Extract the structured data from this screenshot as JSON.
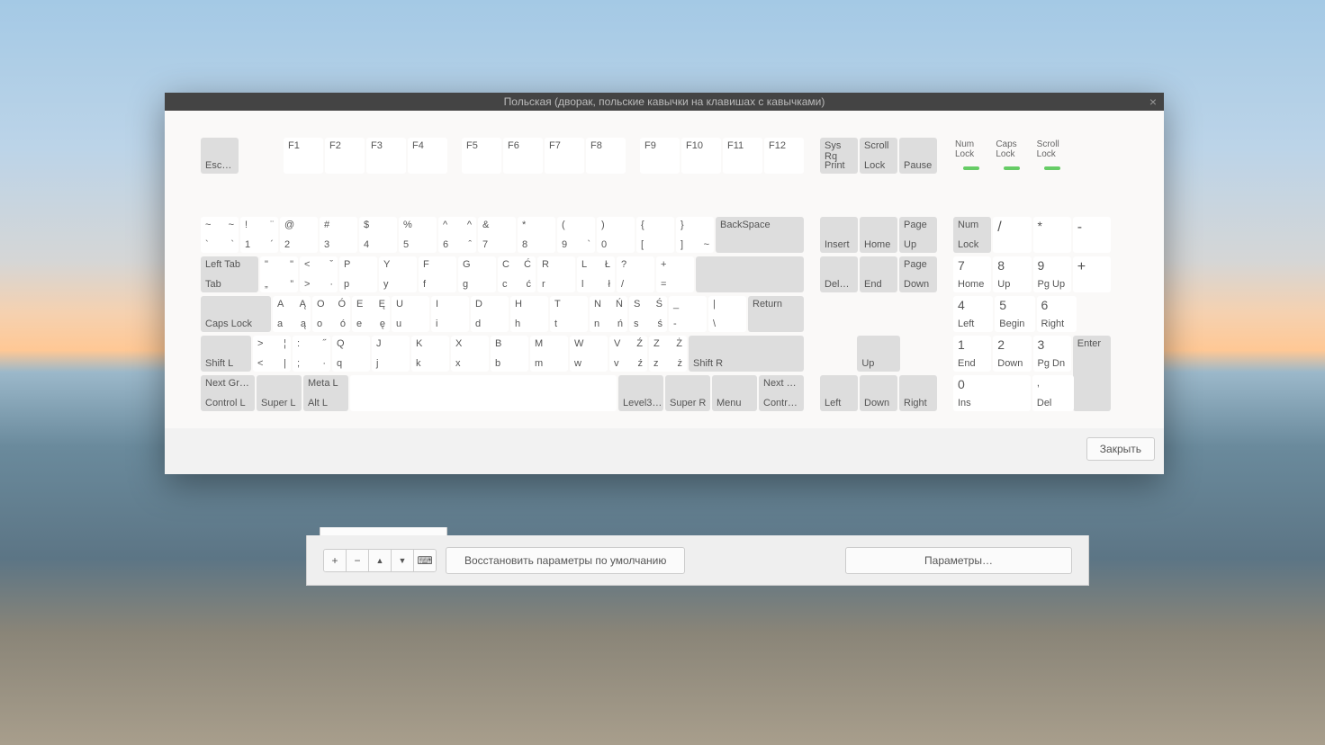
{
  "title": "Польская (дворак, польские кавычки на клавишах с кавычками)",
  "close_btn": "Закрыть",
  "fnrow": {
    "esc": "Esc…",
    "f": [
      "F1",
      "F2",
      "F3",
      "F4",
      "F5",
      "F6",
      "F7",
      "F8",
      "F9",
      "F10",
      "F11",
      "F12"
    ],
    "sys": {
      "l1": "Sys Rq",
      "l2": "Print"
    },
    "scroll": {
      "l1": "Scroll",
      "l2": "Lock"
    },
    "pause": "Pause"
  },
  "ind": {
    "num": "Num Lock",
    "caps": "Caps Lock",
    "scroll": "Scroll Lock"
  },
  "r1": [
    [
      "~",
      "~",
      "`",
      "`"
    ],
    [
      "!",
      "¨",
      "1",
      "´"
    ],
    [
      "@",
      "",
      "2",
      ""
    ],
    [
      "#",
      "",
      "3",
      ""
    ],
    [
      "$",
      "",
      "4",
      ""
    ],
    [
      "%",
      "",
      "5",
      ""
    ],
    [
      "^",
      "^",
      "6",
      "ˆ"
    ],
    [
      "&",
      "",
      "7",
      ""
    ],
    [
      "*",
      "",
      "8",
      ""
    ],
    [
      "(",
      "",
      "9",
      "`"
    ],
    [
      ")",
      "",
      "0",
      ""
    ],
    [
      "{",
      "",
      "[",
      ""
    ],
    [
      "}",
      "",
      "]",
      "~"
    ]
  ],
  "backspace": "BackSpace",
  "tab": {
    "l1": "Left Tab",
    "l2": "Tab"
  },
  "r2": [
    [
      "\"",
      "\"",
      "„",
      "”"
    ],
    [
      "<",
      "ˇ",
      ">",
      "·"
    ],
    [
      "P",
      "",
      "p",
      ""
    ],
    [
      "Y",
      "",
      "y",
      ""
    ],
    [
      "F",
      "",
      "f",
      ""
    ],
    [
      "G",
      "",
      "g",
      ""
    ],
    [
      "C",
      "Ć",
      "c",
      "ć"
    ],
    [
      "R",
      "",
      "r",
      ""
    ],
    [
      "L",
      "Ł",
      "l",
      "ł"
    ],
    [
      "?",
      "",
      "/",
      ""
    ],
    [
      "+",
      "",
      "=",
      ""
    ]
  ],
  "caps": "Caps Lock",
  "return": "Return",
  "r3": [
    [
      "A",
      "Ą",
      "a",
      "ą"
    ],
    [
      "O",
      "Ó",
      "o",
      "ó"
    ],
    [
      "E",
      "Ę",
      "e",
      "ę"
    ],
    [
      "U",
      "",
      "u",
      ""
    ],
    [
      "I",
      "",
      "i",
      ""
    ],
    [
      "D",
      "",
      "d",
      ""
    ],
    [
      "H",
      "",
      "h",
      ""
    ],
    [
      "T",
      "",
      "t",
      ""
    ],
    [
      "N",
      "Ń",
      "n",
      "ń"
    ],
    [
      "S",
      "Ś",
      "s",
      "ś"
    ],
    [
      "_",
      "",
      "-",
      ""
    ],
    [
      "|",
      "",
      "\\",
      ""
    ]
  ],
  "shiftl": "Shift L",
  "shiftr": "Shift R",
  "r4": [
    [
      ">",
      "¦",
      "<",
      "|"
    ],
    [
      ":",
      "˝",
      ";",
      "·"
    ],
    [
      "Q",
      "",
      "q",
      ""
    ],
    [
      "J",
      "",
      "j",
      ""
    ],
    [
      "K",
      "",
      "k",
      ""
    ],
    [
      "X",
      "",
      "x",
      ""
    ],
    [
      "B",
      "",
      "b",
      ""
    ],
    [
      "M",
      "",
      "m",
      ""
    ],
    [
      "W",
      "",
      "w",
      ""
    ],
    [
      "V",
      "Ź",
      "v",
      "ź"
    ],
    [
      "Z",
      "Ż",
      "z",
      "ż"
    ]
  ],
  "bot": {
    "ng": {
      "l1": "Next Gr…",
      "l2": "Control L"
    },
    "superl": "Super L",
    "meta": {
      "l1": "Meta L",
      "l2": "Alt L"
    },
    "lvl3": "Level3…",
    "superr": "Super R",
    "menu": "Menu",
    "nr": {
      "l1": "Next …",
      "l2": "Contr…"
    }
  },
  "nav": {
    "ins": "Insert",
    "home": "Home",
    "pgup": {
      "l1": "Page",
      "l2": "Up"
    },
    "del": "Del…",
    "end": "End",
    "pgdn": {
      "l1": "Page",
      "l2": "Down"
    },
    "up": "Up",
    "left": "Left",
    "down": "Down",
    "right": "Right"
  },
  "num": {
    "nl": {
      "l1": "Num",
      "l2": "Lock"
    },
    "div": "/",
    "mul": "*",
    "sub": "-",
    "7": {
      "l1": "7",
      "l2": "Home"
    },
    "8": {
      "l1": "8",
      "l2": "Up"
    },
    "9": {
      "l1": "9",
      "l2": "Pg Up"
    },
    "add": "+",
    "4": {
      "l1": "4",
      "l2": "Left"
    },
    "5": {
      "l1": "5",
      "l2": "Begin"
    },
    "6": {
      "l1": "6",
      "l2": "Right"
    },
    "1": {
      "l1": "1",
      "l2": "End"
    },
    "2": {
      "l1": "2",
      "l2": "Down"
    },
    "3": {
      "l1": "3",
      "l2": "Pg Dn"
    },
    "0": {
      "l1": "0",
      "l2": "Ins"
    },
    "dec": {
      "l1": ",",
      "l2": "Del"
    },
    "ent": "Enter"
  },
  "under": {
    "add": "+",
    "rem": "−",
    "up": "▲",
    "dn": "▼",
    "kbd": "⌨",
    "reset": "Восстановить параметры по умолчанию",
    "params": "Параметры…"
  }
}
